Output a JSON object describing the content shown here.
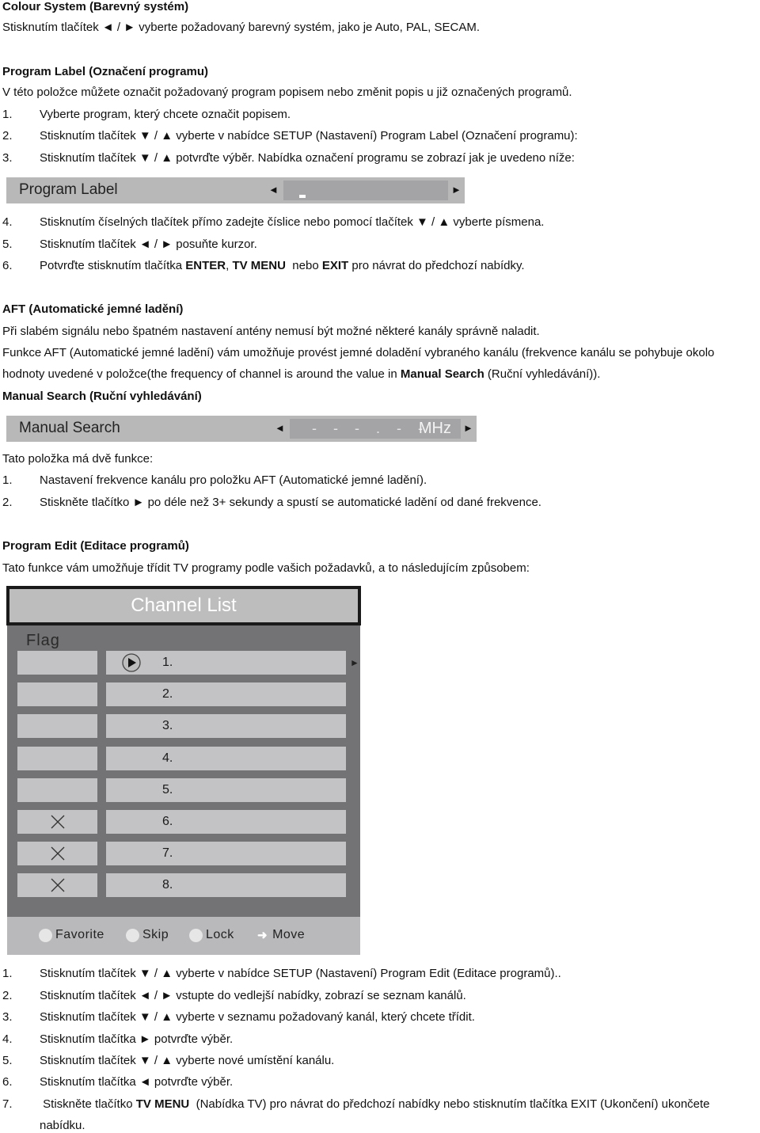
{
  "colour_system": {
    "heading": "Colour System (Barevný systém)",
    "text": "Stisknutím tlačítek ◄ / ► vyberte požadovaný barevný systém, jako je Auto, PAL, SECAM."
  },
  "program_label": {
    "heading": "Program Label (Označení programu)",
    "intro": "V této položce můžete označit požadovaný program popisem nebo změnit popis u již označených programů.",
    "steps_before": [
      {
        "n": "1.",
        "text": "Vyberte program, který chcete označit popisem."
      },
      {
        "n": "2.",
        "text": "Stisknutím tlačítek ▼ / ▲ vyberte v nabídce SETUP (Nastavení) Program Label (Označení programu):"
      },
      {
        "n": "3.",
        "text": "Stisknutím tlačítek ▼ / ▲ potvrďte výběr. Nabídka označení programu se zobrazí jak je uvedeno níže:"
      }
    ],
    "menu": {
      "label": "Program Label",
      "left_arrow": "◄",
      "right_arrow": "►",
      "value": ""
    },
    "steps_after": [
      {
        "n": "4.",
        "text": "Stisknutím číselných tlačítek přímo zadejte číslice nebo pomocí tlačítek ▼ / ▲ vyberte písmena."
      },
      {
        "n": "5.",
        "text": "Stisknutím tlačítek ◄ / ► posuňte kurzor."
      },
      {
        "n": "6.",
        "pre": "Potvrďte stisknutím tlačítka ",
        "b1": "ENTER",
        "mid1": ", ",
        "b2": "TV MENU",
        "mid2": "  nebo ",
        "b3": "EXIT",
        "post": " pro návrat do předchozí nabídky."
      }
    ]
  },
  "aft": {
    "heading": "AFT (Automatické jemné ladění)",
    "p1": "Při slabém signálu nebo špatném nastavení antény nemusí být možné některé kanály správně naladit.",
    "p2": "Funkce AFT (Automatické jemné ladění) vám umožňuje provést jemné doladění vybraného kanálu (frekvence kanálu se pohybuje okolo",
    "p3_pre": "hodnoty uvedené v položce(the frequency of channel is around the value in ",
    "p3_bold": "Manual Search",
    "p3_post": " (Ruční vyhledávání))."
  },
  "manual_search": {
    "heading": "Manual Search (Ruční vyhledávání)",
    "menu": {
      "label": "Manual Search",
      "left_arrow": "◄",
      "right_arrow": "►",
      "value": "- - - . - -",
      "unit": "MHz"
    },
    "intro": "Tato položka má dvě funkce:",
    "steps": [
      {
        "n": "1.",
        "text": "Nastavení frekvence kanálu pro položku AFT (Automatické jemné ladění)."
      },
      {
        "n": "2.",
        "text": "Stiskněte tlačítko ► po déle než 3+ sekundy a spustí se automatické ladění od dané frekvence."
      }
    ]
  },
  "program_edit": {
    "heading": "Program Edit (Editace programů)",
    "intro": "Tato funkce vám umožňuje třídit TV programy podle vašich požadavků, a to následujícím způsobem:",
    "channel_list": {
      "title": "Channel List",
      "flag_header": "Flag",
      "selected_arrow": "►",
      "rows": [
        {
          "num": "1.",
          "flag": "",
          "selected": true
        },
        {
          "num": "2.",
          "flag": "",
          "selected": false
        },
        {
          "num": "3.",
          "flag": "",
          "selected": false
        },
        {
          "num": "4.",
          "flag": "",
          "selected": false
        },
        {
          "num": "5.",
          "flag": "",
          "selected": false
        },
        {
          "num": "6.",
          "flag": "skip",
          "selected": false
        },
        {
          "num": "7.",
          "flag": "skip",
          "selected": false
        },
        {
          "num": "8.",
          "flag": "skip",
          "selected": false
        }
      ],
      "legend": {
        "favorite": "Favorite",
        "skip": "Skip",
        "lock": "Lock",
        "move": "Move"
      }
    },
    "steps": [
      {
        "n": "1.",
        "text": "Stisknutím tlačítek ▼ / ▲ vyberte v nabídce SETUP (Nastavení) Program Edit (Editace programů).."
      },
      {
        "n": "2.",
        "text": "Stisknutím tlačítek ◄ / ► vstupte do vedlejší nabídky, zobrazí se seznam kanálů."
      },
      {
        "n": "3.",
        "text": "Stisknutím tlačítek ▼ / ▲ vyberte v seznamu požadovaný kanál, který chcete třídit."
      },
      {
        "n": "4.",
        "text": "Stisknutím tlačítka ► potvrďte výběr."
      },
      {
        "n": "5.",
        "text": "Stisknutím tlačítek ▼ / ▲ vyberte nové umístění kanálu."
      },
      {
        "n": "6.",
        "text": "Stisknutím tlačítka ◄ potvrďte výběr."
      },
      {
        "n": "7.",
        "pre": " Stiskněte tlačítko ",
        "bold": "TV MENU",
        "post": "  (Nabídka TV) pro návrat do předchozí nabídky nebo stisknutím tlačítka EXIT (Ukončení) ukončete",
        "cont": "nabídku."
      }
    ]
  }
}
